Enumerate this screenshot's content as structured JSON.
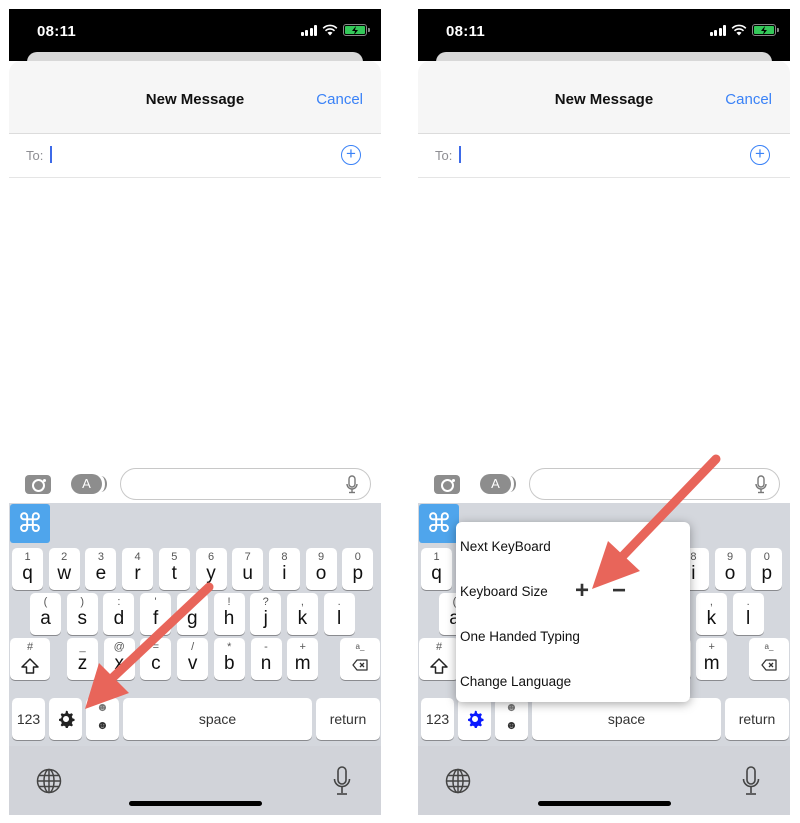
{
  "status_bar": {
    "time": "08:11"
  },
  "navbar": {
    "title": "New Message",
    "cancel_label": "Cancel"
  },
  "recipient": {
    "label": "To:",
    "value": "",
    "add_icon": "plus-circle-icon"
  },
  "composer": {
    "placeholder": "",
    "camera_icon": "camera-icon",
    "appstore_icon": "app-store-icon",
    "mic_icon": "microphone-icon"
  },
  "keyboard": {
    "command_icon": "command-icon",
    "rows": [
      [
        {
          "pri": "q",
          "sec": "1"
        },
        {
          "pri": "w",
          "sec": "2"
        },
        {
          "pri": "e",
          "sec": "3"
        },
        {
          "pri": "r",
          "sec": "4"
        },
        {
          "pri": "t",
          "sec": "5"
        },
        {
          "pri": "y",
          "sec": "6"
        },
        {
          "pri": "u",
          "sec": "7"
        },
        {
          "pri": "i",
          "sec": "8"
        },
        {
          "pri": "o",
          "sec": "9"
        },
        {
          "pri": "p",
          "sec": "0"
        }
      ],
      [
        {
          "pri": "a",
          "sec": "("
        },
        {
          "pri": "s",
          "sec": ")"
        },
        {
          "pri": "d",
          "sec": ":"
        },
        {
          "pri": "f",
          "sec": "'"
        },
        {
          "pri": "g",
          "sec": "&"
        },
        {
          "pri": "h",
          "sec": "!"
        },
        {
          "pri": "j",
          "sec": "?"
        },
        {
          "pri": "k",
          "sec": ","
        },
        {
          "pri": "l",
          "sec": "."
        }
      ],
      [
        {
          "pri": "z",
          "sec": "_"
        },
        {
          "pri": "x",
          "sec": "@"
        },
        {
          "pri": "c",
          "sec": "="
        },
        {
          "pri": "v",
          "sec": "/"
        },
        {
          "pri": "b",
          "sec": "*"
        },
        {
          "pri": "n",
          "sec": "-"
        },
        {
          "pri": "m",
          "sec": "+"
        }
      ]
    ],
    "shift_sec": "#",
    "delete_sec": "a_",
    "numbers_label": "123",
    "space_label": "space",
    "return_label": "return",
    "settings_icon": "gear-icon",
    "globe_icon": "globe-icon",
    "dictation_icon": "microphone-icon"
  },
  "left_panel": {
    "gear_color": "#222222"
  },
  "right_panel": {
    "gear_color": "#0a1aff",
    "menu": {
      "items": [
        "Next KeyBoard",
        "Keyboard Size",
        "One Handed Typing",
        "Change Language"
      ],
      "size_increase": "+",
      "size_decrease": "−"
    }
  },
  "annotation": {
    "arrow_color": "#e8655a"
  }
}
